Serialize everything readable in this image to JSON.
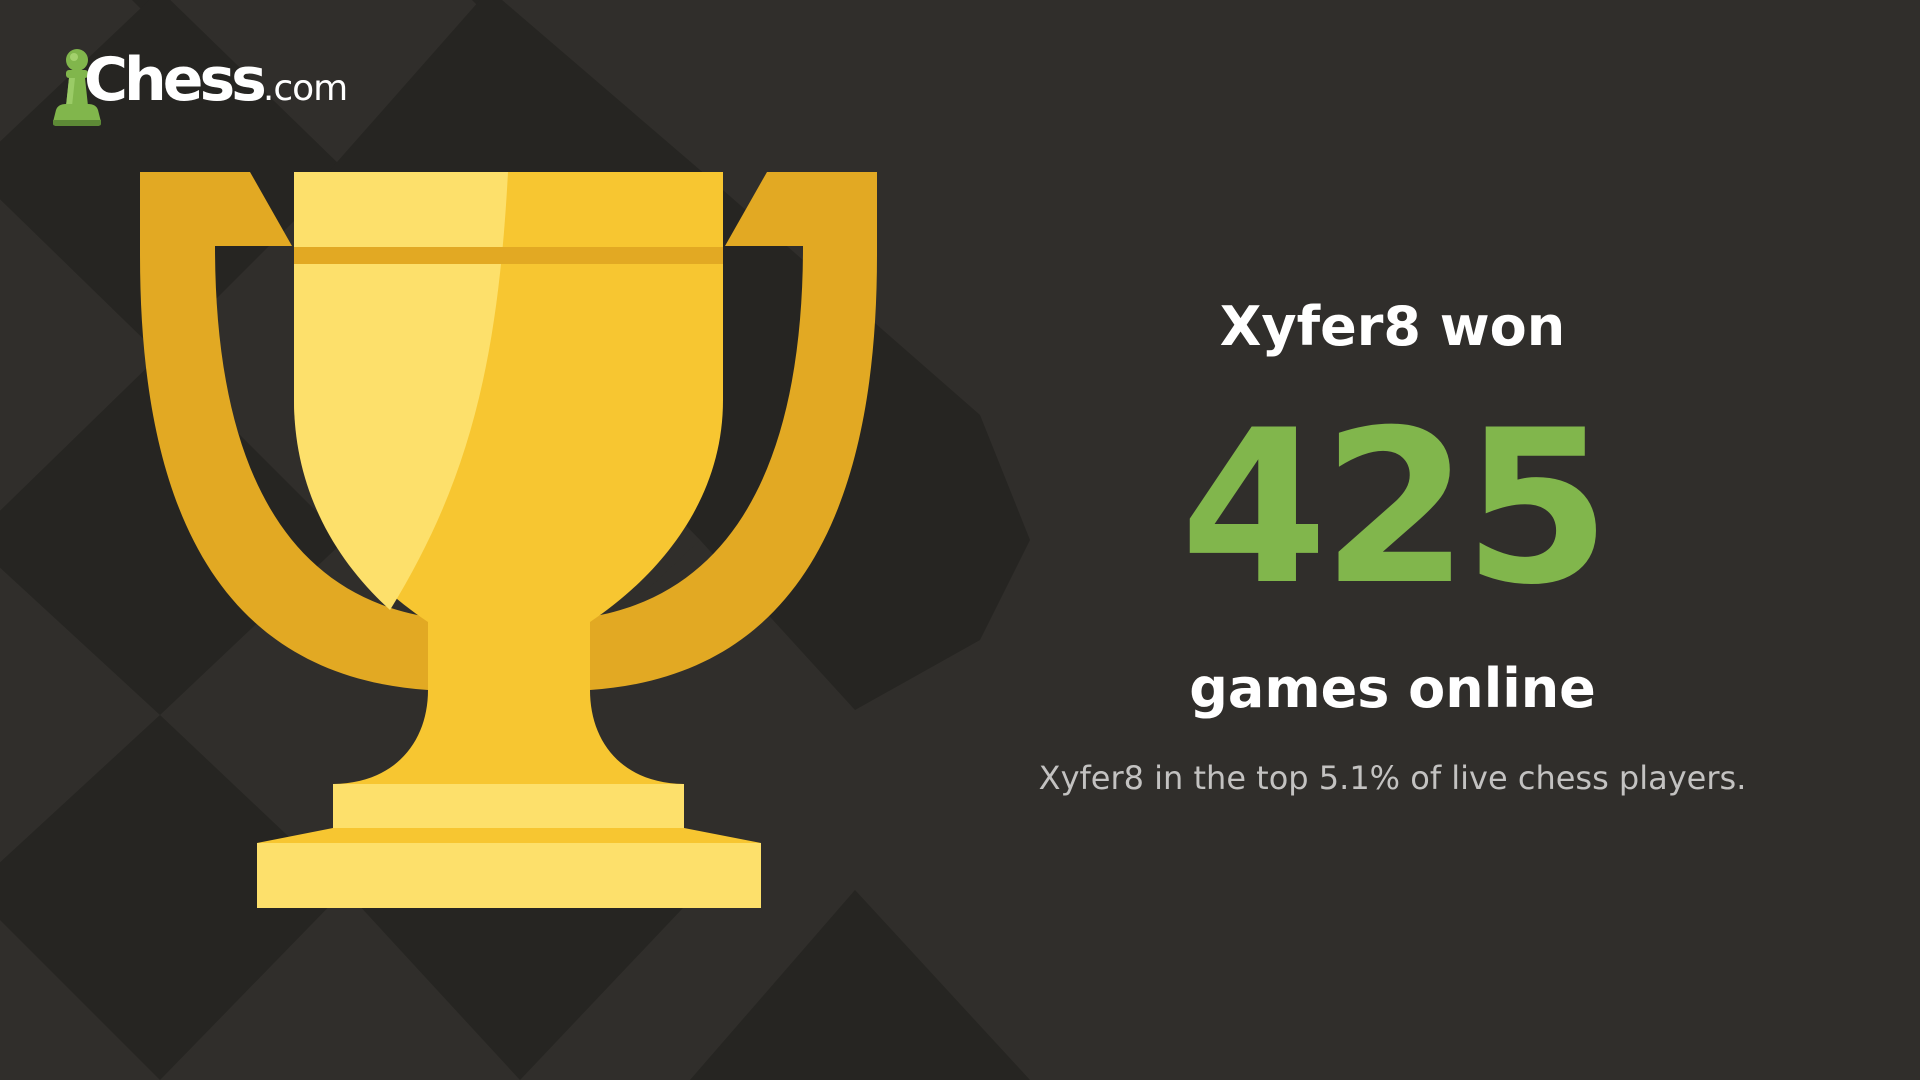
{
  "brand": {
    "name": "Chess",
    "tld": ".com",
    "accent_color": "#81b64c",
    "icon": "pawn-icon"
  },
  "card": {
    "headline_prefix": "Xyfer8 won",
    "games_won_count": "425",
    "headline_suffix": "games online",
    "percentile_text": "Xyfer8 in the top 5.1% of live chess players.",
    "illustration": "trophy-icon"
  },
  "colors": {
    "background": "#302e2b",
    "diamond_dark": "#262522",
    "trophy_gold": "#f7c631",
    "trophy_light": "#fde06b",
    "trophy_handle": "#e2a923",
    "count_green": "#81b64c",
    "subtext_gray": "#c3c2c1"
  }
}
